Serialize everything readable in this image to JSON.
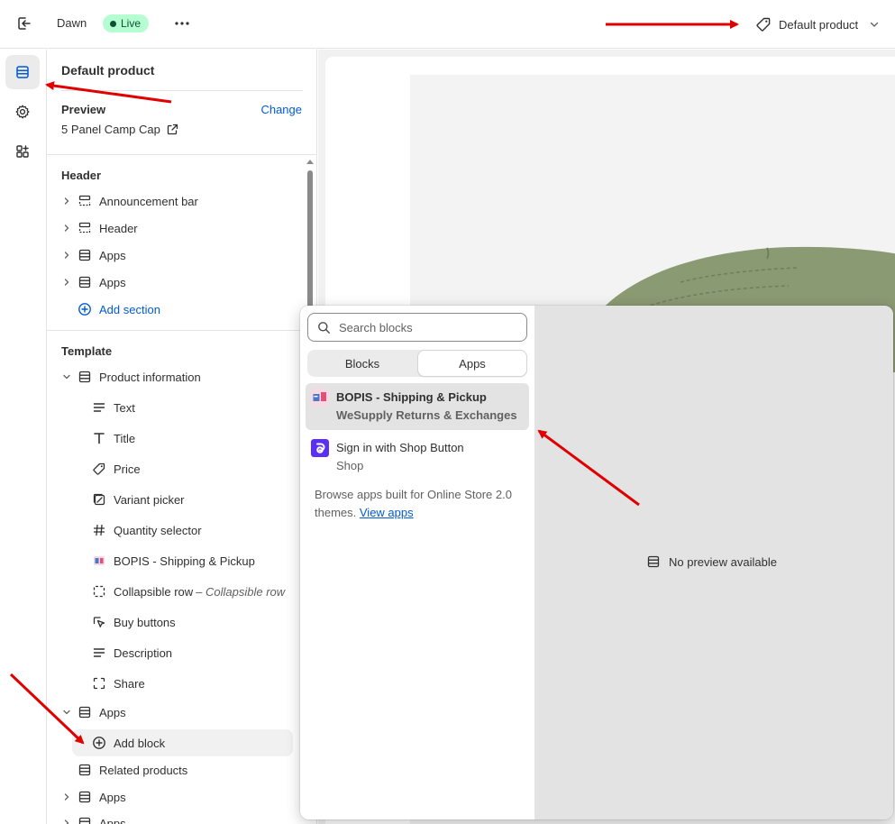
{
  "topbar": {
    "theme_name": "Dawn",
    "status_badge": "Live",
    "page_selector": "Default product"
  },
  "sidebar": {
    "title": "Default product",
    "preview_label": "Preview",
    "preview_change": "Change",
    "preview_value": "5 Panel Camp Cap",
    "header_group": {
      "heading": "Header",
      "items": [
        {
          "label": "Announcement bar"
        },
        {
          "label": "Header"
        },
        {
          "label": "Apps"
        },
        {
          "label": "Apps"
        }
      ],
      "add_section": "Add section"
    },
    "template_group": {
      "heading": "Template",
      "section": "Product information",
      "blocks": [
        {
          "label": "Text",
          "icon": "text-align-icon"
        },
        {
          "label": "Title",
          "icon": "title-icon"
        },
        {
          "label": "Price",
          "icon": "price-tag-icon"
        },
        {
          "label": "Variant picker",
          "icon": "variant-icon"
        },
        {
          "label": "Quantity selector",
          "icon": "hash-icon"
        },
        {
          "label": "BOPIS - Shipping & Pickup",
          "icon": "bopis-app-icon"
        },
        {
          "label": "Collapsible row",
          "suffix": "– Collapsible row",
          "icon": "dashed-box-icon"
        },
        {
          "label": "Buy buttons",
          "icon": "cursor-icon"
        },
        {
          "label": "Description",
          "icon": "text-align-icon"
        },
        {
          "label": "Share",
          "icon": "share-box-icon"
        }
      ],
      "apps_section": "Apps",
      "add_block": "Add block",
      "after": [
        {
          "label": "Related products"
        },
        {
          "label": "Apps"
        },
        {
          "label": "Apps"
        }
      ]
    }
  },
  "popover": {
    "search_placeholder": "Search blocks",
    "tabs": [
      "Blocks",
      "Apps"
    ],
    "active_tab": "Apps",
    "apps": [
      {
        "title": "BOPIS - Shipping & Pickup",
        "subtitle": "WeSupply Returns & Exchanges"
      },
      {
        "title": "Sign in with Shop Button",
        "subtitle": "Shop"
      }
    ],
    "browse_text": "Browse apps built for Online Store 2.0 themes.",
    "browse_link": "View apps",
    "no_preview": "No preview available"
  },
  "colors": {
    "accent": "#005bd3",
    "live_badge_bg": "#b4fed2",
    "annotation_arrow": "#e00000",
    "shop_purple": "#5a31f4",
    "cap_green": "#8a9a72"
  }
}
